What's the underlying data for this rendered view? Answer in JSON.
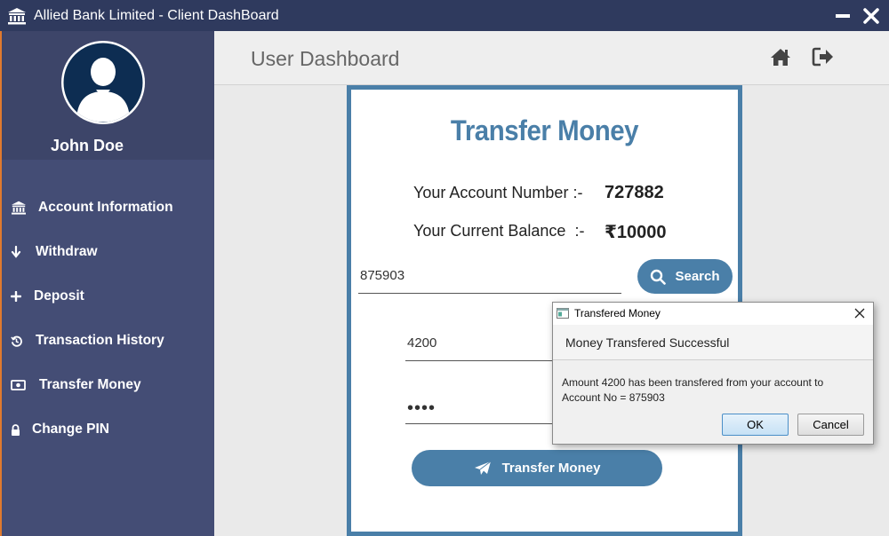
{
  "window": {
    "title": "Allied Bank Limited - Client DashBoard",
    "icon": "bank-icon"
  },
  "sidebar": {
    "user_name": "John Doe",
    "items": [
      {
        "label": "Account Information",
        "icon": "bank-icon"
      },
      {
        "label": "Withdraw",
        "icon": "arrow-down-icon"
      },
      {
        "label": "Deposit",
        "icon": "plus-icon"
      },
      {
        "label": "Transaction History",
        "icon": "history-icon"
      },
      {
        "label": "Transfer Money",
        "icon": "money-icon"
      },
      {
        "label": "Change PIN",
        "icon": "lock-icon"
      }
    ]
  },
  "header": {
    "title": "User Dashboard",
    "home_icon": "home-icon",
    "logout_icon": "sign-out-icon"
  },
  "card": {
    "title": "Transfer Money",
    "account_label": "Your Account Number :-",
    "account_value": "727882",
    "balance_label": "Your Current Balance  :-",
    "balance_value": "₹10000",
    "recipient_value": "875903",
    "amount_value": "4200",
    "pin_value": "••••",
    "search_label": "Search",
    "transfer_label": "Transfer Money"
  },
  "dialog": {
    "title": "Transfered Money",
    "header": "Money Transfered Successful",
    "message_line1": "Amount 4200 has been transfered from your account to",
    "message_line2": "Account No = 875903",
    "ok_label": "OK",
    "cancel_label": "Cancel"
  },
  "colors": {
    "titlebar": "#2f3a5e",
    "sidebar": "#444d75",
    "accent": "#4a7fa8"
  }
}
